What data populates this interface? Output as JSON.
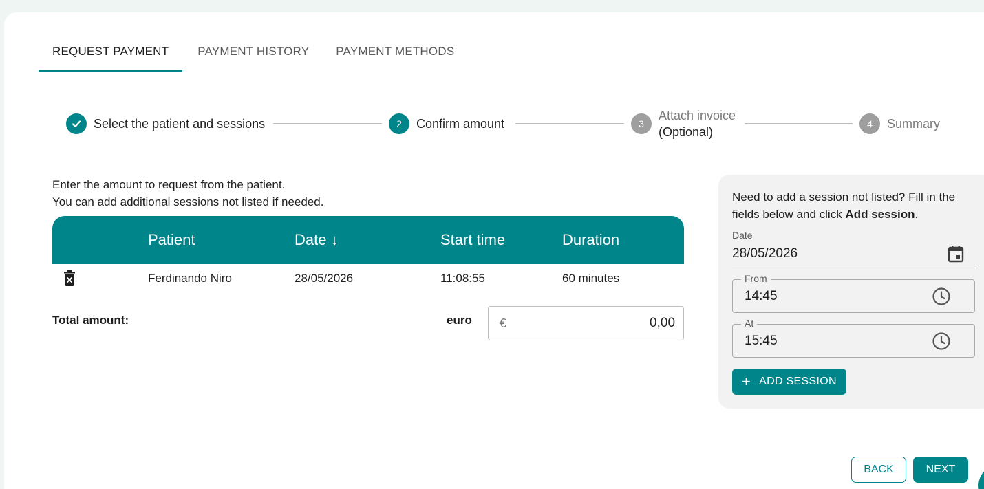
{
  "tabs": [
    {
      "label": "REQUEST PAYMENT",
      "active": true
    },
    {
      "label": "PAYMENT HISTORY",
      "active": false
    },
    {
      "label": "PAYMENT METHODS",
      "active": false
    }
  ],
  "stepper": {
    "steps": [
      {
        "number": "",
        "label": "Select the patient and sessions",
        "state": "done"
      },
      {
        "number": "2",
        "label": "Confirm amount",
        "state": "active"
      },
      {
        "number": "3",
        "label": "Attach invoice",
        "sublabel": "(Optional)",
        "state": "pending"
      },
      {
        "number": "4",
        "label": "Summary",
        "state": "pending"
      }
    ]
  },
  "intro": {
    "line1": "Enter the amount to request from the patient.",
    "line2": "You can add additional sessions not listed if needed."
  },
  "table": {
    "headers": {
      "patient": "Patient",
      "date": "Date ↓",
      "start_time": "Start time",
      "duration": "Duration"
    },
    "rows": [
      {
        "patient": "Ferdinando Niro",
        "date": "28/05/2026",
        "start_time": "11:08:55",
        "duration": "60 minutes"
      }
    ]
  },
  "total": {
    "label": "Total amount:",
    "currency": "euro",
    "symbol": "€",
    "value": "0,00"
  },
  "panel": {
    "text_prefix": "Need to add a session not listed? Fill in the fields below and click ",
    "text_bold": "Add session",
    "text_suffix": ".",
    "date_label": "Date",
    "date_value": "28/05/2026",
    "from_label": "From",
    "from_value": "14:45",
    "at_label": "At",
    "at_value": "15:45",
    "add_button": "ADD SESSION"
  },
  "footer": {
    "back": "BACK",
    "next": "NEXT"
  },
  "colors": {
    "accent": "#00868a",
    "pending_step": "#9e9e9e",
    "panel_bg": "#f2f2f2"
  }
}
